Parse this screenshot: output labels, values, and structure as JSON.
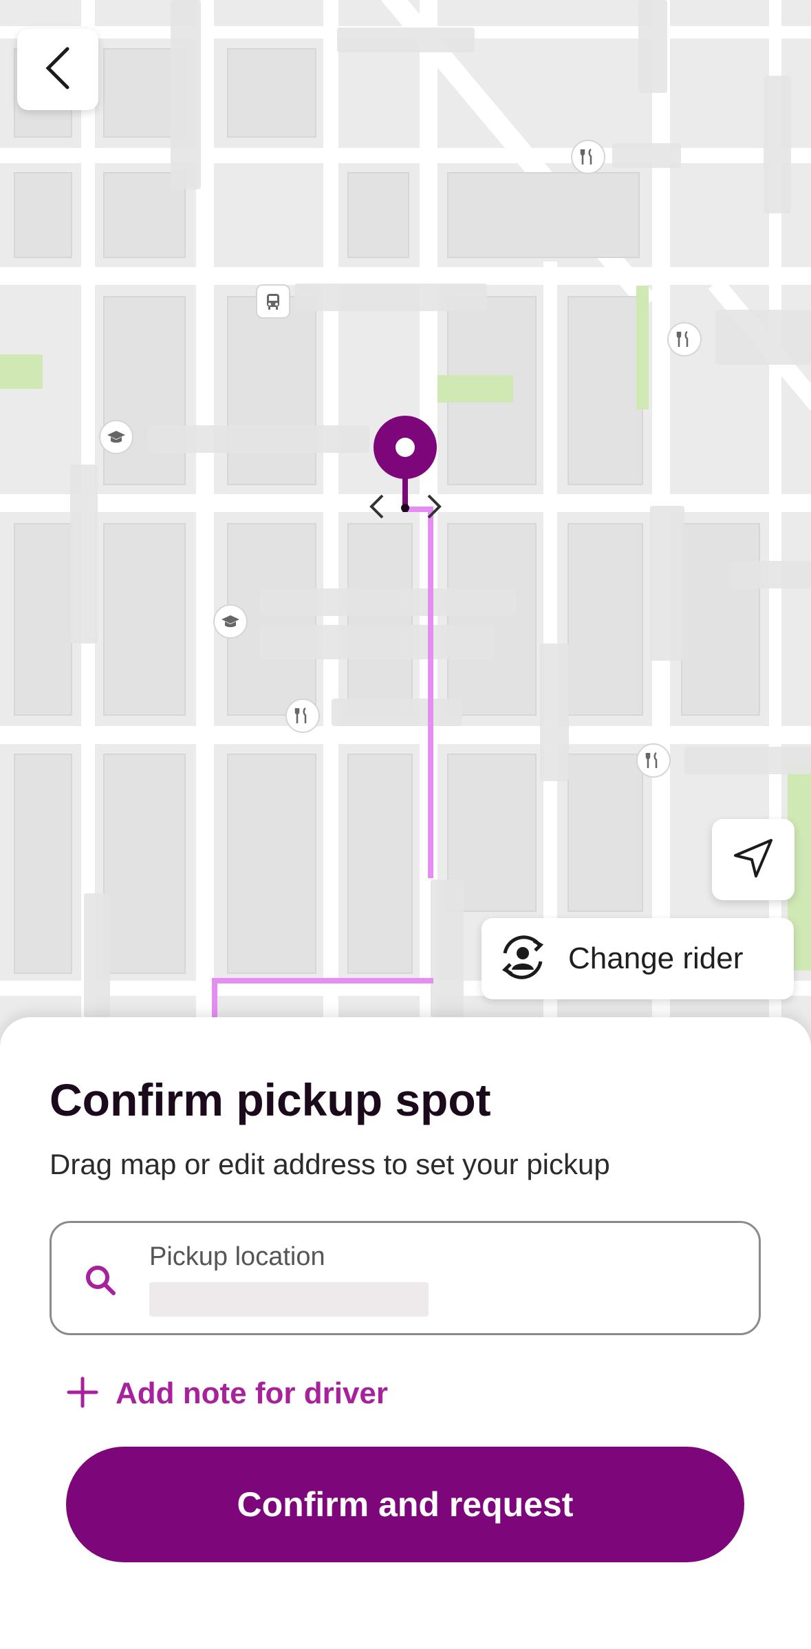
{
  "map": {
    "poi_icons": [
      "restaurant-icon",
      "bus-icon",
      "school-icon",
      "restaurant-icon",
      "school-icon",
      "restaurant-icon",
      "restaurant-icon"
    ]
  },
  "buttons": {
    "back_icon": "chevron-left-icon",
    "locate_icon": "navigation-arrow-icon",
    "change_rider_label": "Change rider"
  },
  "sheet": {
    "title": "Confirm pickup spot",
    "subtitle": "Drag map or edit address to set your pickup",
    "pickup_field": {
      "label": "Pickup location",
      "value": ""
    },
    "add_note_label": "Add note for driver",
    "confirm_label": "Confirm and request"
  },
  "colors": {
    "brand": "#7c067a",
    "accent": "#a8219c",
    "route": "#e58ef2"
  }
}
